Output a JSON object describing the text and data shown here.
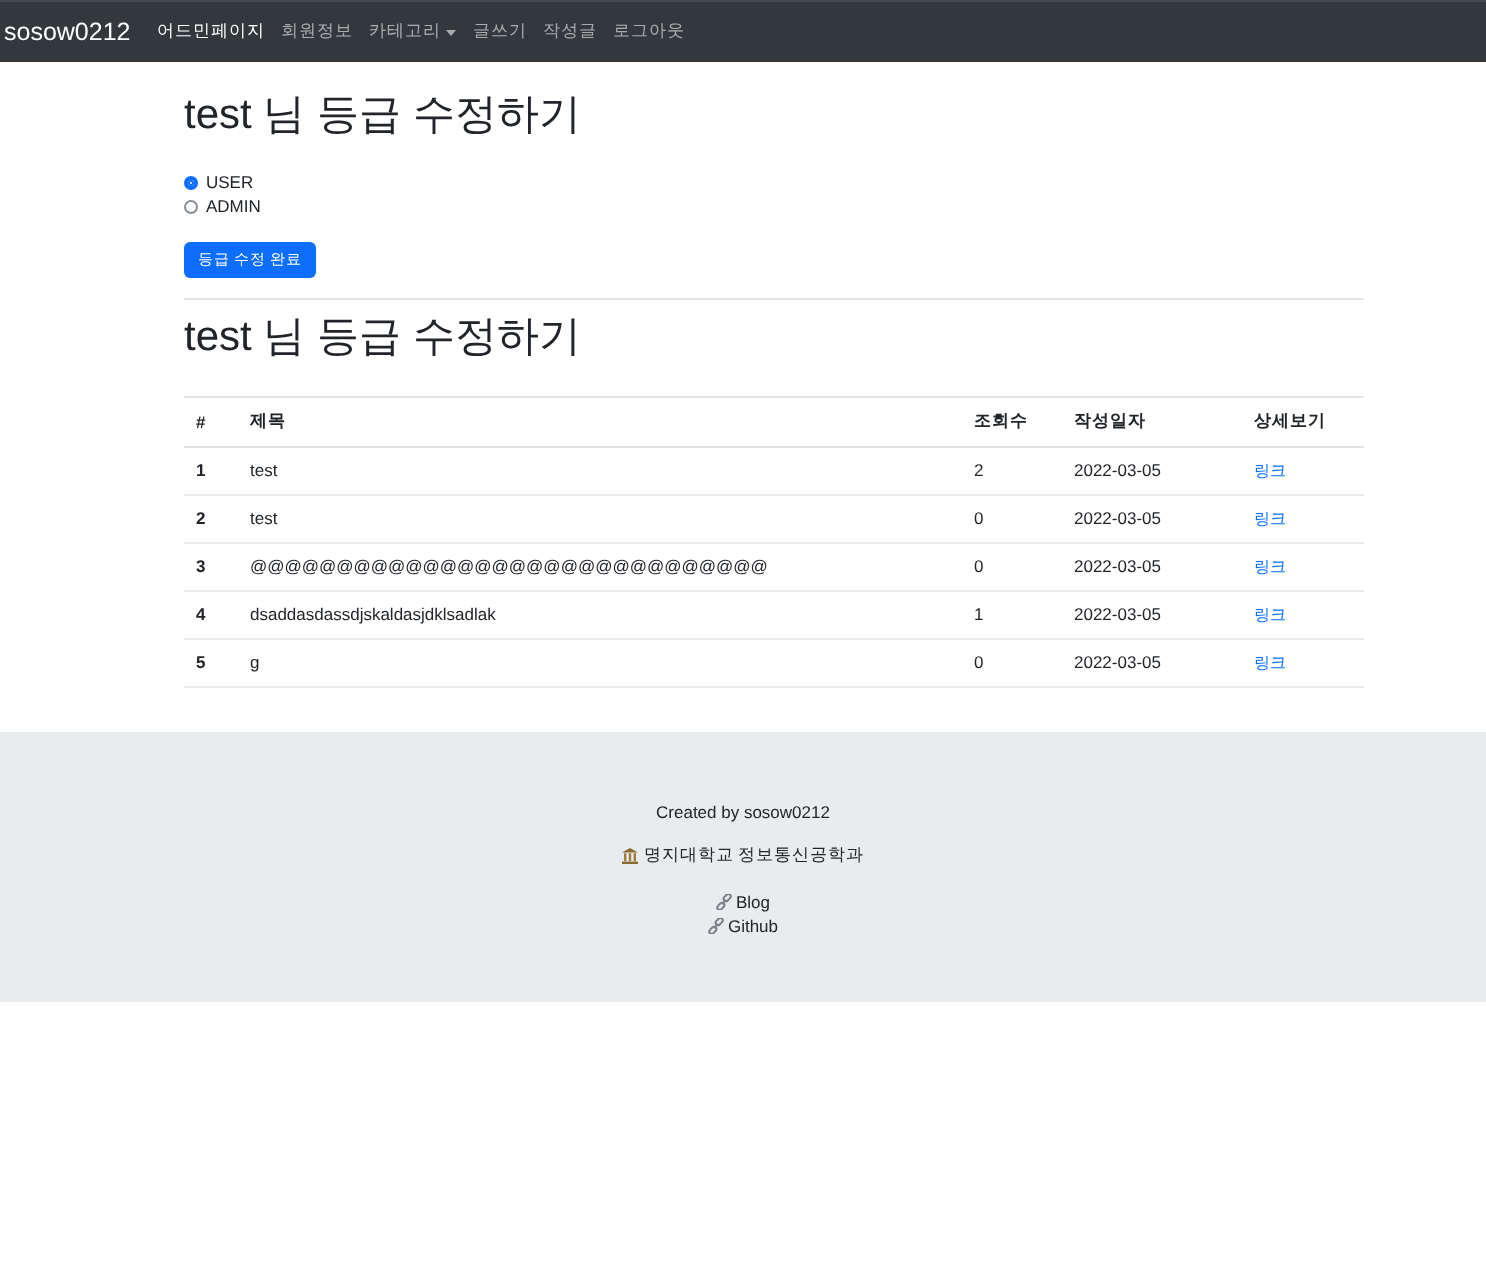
{
  "navbar": {
    "brand": "sosow0212",
    "items": [
      {
        "label": "어드민페이지",
        "kind": "link",
        "selected": true
      },
      {
        "label": "회원정보",
        "kind": "link",
        "selected": false
      },
      {
        "label": "카테고리",
        "kind": "dropdown",
        "selected": false
      },
      {
        "label": "글쓰기",
        "kind": "link",
        "selected": false
      },
      {
        "label": "작성글",
        "kind": "link",
        "selected": false
      },
      {
        "label": "로그아웃",
        "kind": "link",
        "selected": false
      }
    ]
  },
  "role_form": {
    "title": "test 님 등급 수정하기",
    "options": [
      {
        "label": "USER",
        "selected": true
      },
      {
        "label": "ADMIN",
        "selected": false
      }
    ],
    "submit": "등급 수정 완료"
  },
  "posts": {
    "title": "test 님 등급 수정하기",
    "columns": [
      "#",
      "제목",
      "조회수",
      "작성일자",
      "상세보기"
    ],
    "rows": [
      {
        "number": "1",
        "title": "test",
        "views": "2",
        "date": "2022-03-05",
        "link": "링크"
      },
      {
        "number": "2",
        "title": "test",
        "views": "0",
        "date": "2022-03-05",
        "link": "링크"
      },
      {
        "number": "3",
        "title": "@@@@@@@@@@@@@@@@@@@@@@@@@@@@@@",
        "views": "0",
        "date": "2022-03-05",
        "link": "링크"
      },
      {
        "number": "4",
        "title": "dsaddasdassdjskaldasjdklsadlak",
        "views": "1",
        "date": "2022-03-05",
        "link": "링크"
      },
      {
        "number": "5",
        "title": "g",
        "views": "0",
        "date": "2022-03-05",
        "link": "링크"
      }
    ]
  },
  "footer": {
    "credit": "Created by sosow0212",
    "school": "명지대학교 정보통신공학과",
    "links": [
      {
        "label": "Blog"
      },
      {
        "label": "Github"
      }
    ]
  }
}
